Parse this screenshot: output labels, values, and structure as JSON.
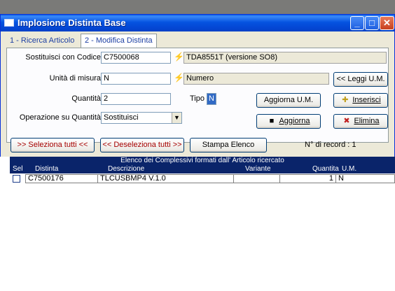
{
  "window": {
    "title": "Implosione Distinta Base"
  },
  "tabs": [
    {
      "label": "1 - Ricerca Articolo"
    },
    {
      "label": "2 - Modifica Distinta"
    }
  ],
  "form": {
    "sostituisci_label": "Sostituisci con  Codice",
    "sostituisci_value": "C7500068",
    "sostituisci_desc": "TDA8551T (versione SO8)",
    "unita_label": "Unità di misura",
    "unita_value": "N",
    "unita_desc": "Numero",
    "leggi_um_button": "<< Leggi U.M.",
    "quantita_label": "Quantità",
    "quantita_value": "2",
    "tipo_label": "Tipo",
    "tipo_value": "N",
    "aggiorna_um_button": "Aggiorna U.M.",
    "inserisci_button": "Inserisci",
    "operazione_label": "Operazione su Quantità",
    "operazione_value": "Sostituisci",
    "aggiorna_button": "Aggiorna",
    "elimina_button": "Elimina"
  },
  "toolbar": {
    "seleziona_tutti": ">> Seleziona tutti <<",
    "deseleziona_tutti": "<< Deseleziona tutti >>",
    "stampa_elenco": "Stampa Elenco",
    "records_label": "N° di record : 1"
  },
  "grid": {
    "caption": "Elenco dei Complessivi formati dall' Articolo ricercato",
    "columns": [
      "Sel",
      "Distinta",
      "Descrizione",
      "Variante",
      "Quantita",
      "U.M."
    ],
    "rows": [
      {
        "sel": false,
        "distinta": "C7500176",
        "descrizione": "TLCUSBMP4 V.1.0",
        "variante": "",
        "quantita": "1",
        "um": "N"
      }
    ]
  },
  "colors": {
    "titlebar": "#0553e0",
    "grid_header": "#0a246a",
    "window_bg": "#ece9d8",
    "link_blue": "#1c3fa3",
    "red_text": "#a60000"
  },
  "icons": [
    "window-app-icon",
    "minimize-icon",
    "maximize-icon",
    "close-icon",
    "lightning-icon",
    "insert-icon",
    "save-disk-icon",
    "delete-icon",
    "dropdown-arrow-icon",
    "checkbox-icon"
  ]
}
